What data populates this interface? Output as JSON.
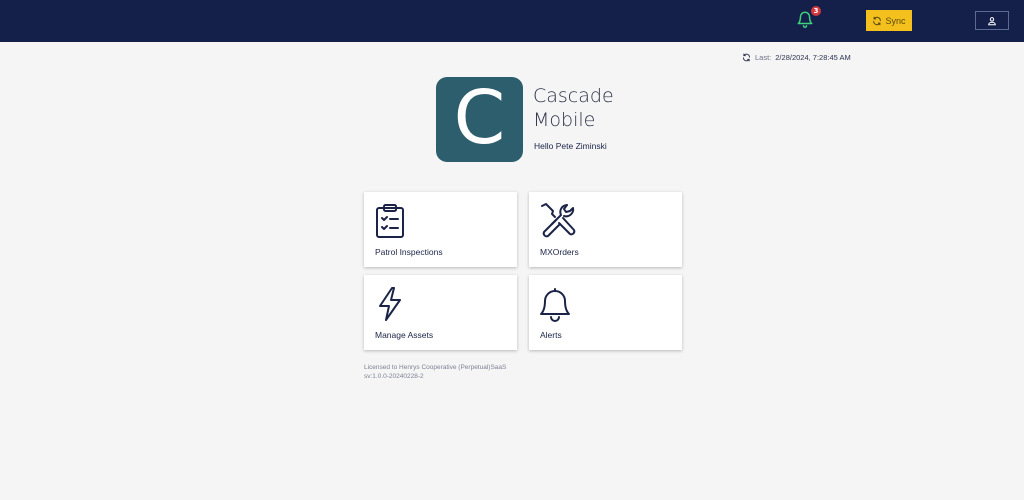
{
  "header": {
    "notifications": {
      "count": "3",
      "icon": "bell-icon",
      "color": "#3fd07e"
    },
    "sync": {
      "label": "Sync",
      "color": "#f4c01e"
    },
    "user": {
      "icon": "user-icon"
    }
  },
  "status": {
    "last_sync_label": "Last:",
    "last_sync_value": "2/28/2024, 7:28:45 AM"
  },
  "app": {
    "logo_letter": "C",
    "title_line1": "Cascade",
    "title_line2": "Mobile",
    "greeting": "Hello Pete Ziminski",
    "brand_color": "#2d5e6e"
  },
  "tiles": [
    {
      "label": "Patrol Inspections",
      "icon": "clipboard-checklist-icon"
    },
    {
      "label": "MXOrders",
      "icon": "tools-icon"
    },
    {
      "label": "Manage Assets",
      "icon": "lightning-bolt-icon"
    },
    {
      "label": "Alerts",
      "icon": "bell-icon"
    }
  ],
  "footer": {
    "license": "Licensed to Henrys Cooperative (Perpetual)SaaS",
    "version": "sv:1.0.0-20240228-2"
  }
}
